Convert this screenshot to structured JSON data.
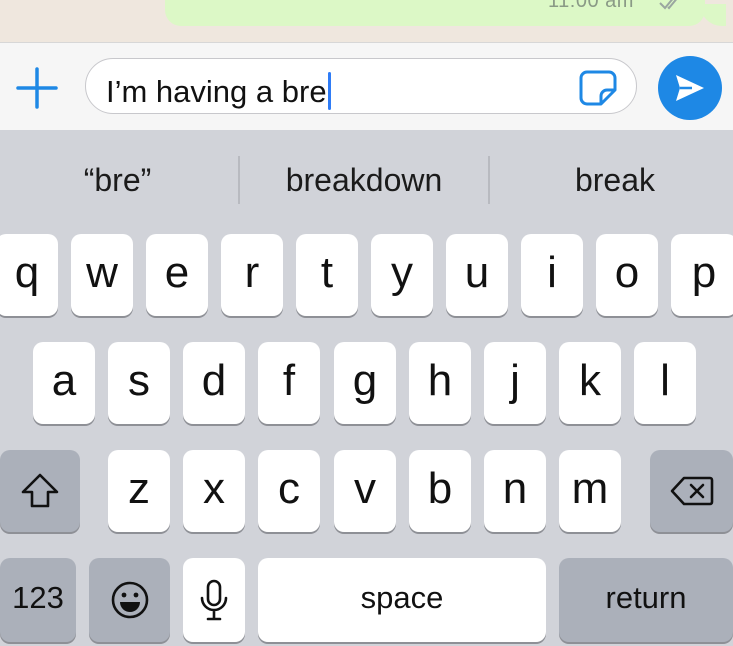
{
  "chat": {
    "last_message_time": "11:00 am"
  },
  "input_bar": {
    "text": "I’m having a bre"
  },
  "keyboard": {
    "suggestions": [
      "“bre”",
      "breakdown",
      "break"
    ],
    "row1": [
      "q",
      "w",
      "e",
      "r",
      "t",
      "y",
      "u",
      "i",
      "o",
      "p"
    ],
    "row2": [
      "a",
      "s",
      "d",
      "f",
      "g",
      "h",
      "j",
      "k",
      "l"
    ],
    "row3": [
      "z",
      "x",
      "c",
      "v",
      "b",
      "n",
      "m"
    ],
    "numbers_label": "123",
    "space_label": "space",
    "return_label": "return"
  },
  "colors": {
    "accent": "#1e88e5",
    "keyboard_bg": "#d1d3d9",
    "key_bg": "#ffffff",
    "function_key_bg": "#abb0ba",
    "chat_bubble": "#dcf8c6"
  },
  "icons": {
    "plus": "plus-icon",
    "sticker": "sticker-icon",
    "send": "send-icon",
    "shift": "shift-icon",
    "delete": "delete-icon",
    "emoji": "emoji-icon",
    "microphone": "microphone-icon",
    "read_receipt": "double-check-icon"
  }
}
